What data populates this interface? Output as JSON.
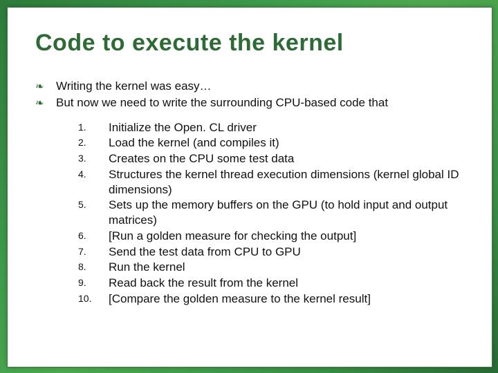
{
  "title": "Code to execute the kernel",
  "bullets": [
    "Writing the kernel was easy…",
    "But now we need to write the surrounding CPU-based code that"
  ],
  "steps": [
    "Initialize the Open. CL driver",
    "Load the kernel (and compiles it)",
    "Creates on the CPU some test data",
    "Structures the kernel thread execution dimensions (kernel global ID dimensions)",
    "Sets up the memory buffers on the GPU (to hold input and output matrices)",
    "[Run a golden measure for checking the output]",
    "Send the test data from CPU to GPU",
    "Run the kernel",
    "Read back the result from the kernel",
    "[Compare the golden measure to the kernel result]"
  ],
  "numbers": [
    "1.",
    "2.",
    "3.",
    "4.",
    "5.",
    "6.",
    "7.",
    "8.",
    "9.",
    "10."
  ]
}
